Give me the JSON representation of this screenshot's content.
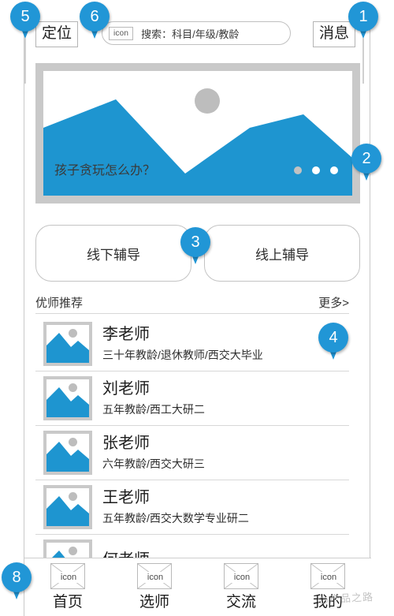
{
  "header": {
    "location_label": "定位",
    "message_label": "消息",
    "message_badge": "",
    "search": {
      "icon_label": "icon",
      "placeholder": "搜索：科目/年级/教龄"
    }
  },
  "banner": {
    "title": "孩子贪玩怎么办？",
    "dots_total": 3,
    "active_dot_index": 0
  },
  "quick_actions": [
    {
      "label": "线下辅导"
    },
    {
      "label": "线上辅导"
    }
  ],
  "section": {
    "title": "优师推荐",
    "more_label": "更多>"
  },
  "teachers": [
    {
      "name": "李老师",
      "desc": "三十年教龄/退休教师/西交大毕业"
    },
    {
      "name": "刘老师",
      "desc": "五年教龄/西工大研二"
    },
    {
      "name": "张老师",
      "desc": "六年教龄/西交大研三"
    },
    {
      "name": "王老师",
      "desc": "五年教龄/西交大数学专业研二"
    },
    {
      "name": "何老师",
      "desc": ""
    }
  ],
  "tabbar": [
    {
      "icon_label": "icon",
      "label": "首页"
    },
    {
      "icon_label": "icon",
      "label": "选师"
    },
    {
      "icon_label": "icon",
      "label": "交流"
    },
    {
      "icon_label": "icon",
      "label": "我的"
    }
  ],
  "watermark": "产品之路",
  "annotations": [
    {
      "number": "1"
    },
    {
      "number": "2"
    },
    {
      "number": "3"
    },
    {
      "number": "4"
    },
    {
      "number": "5"
    },
    {
      "number": "6"
    },
    {
      "number": "8"
    }
  ],
  "colors": {
    "accent_blue": "#2196d6",
    "image_blue": "#1e95d0",
    "badge_red": "#e8221c",
    "frame_gray": "#c9c9c9"
  }
}
